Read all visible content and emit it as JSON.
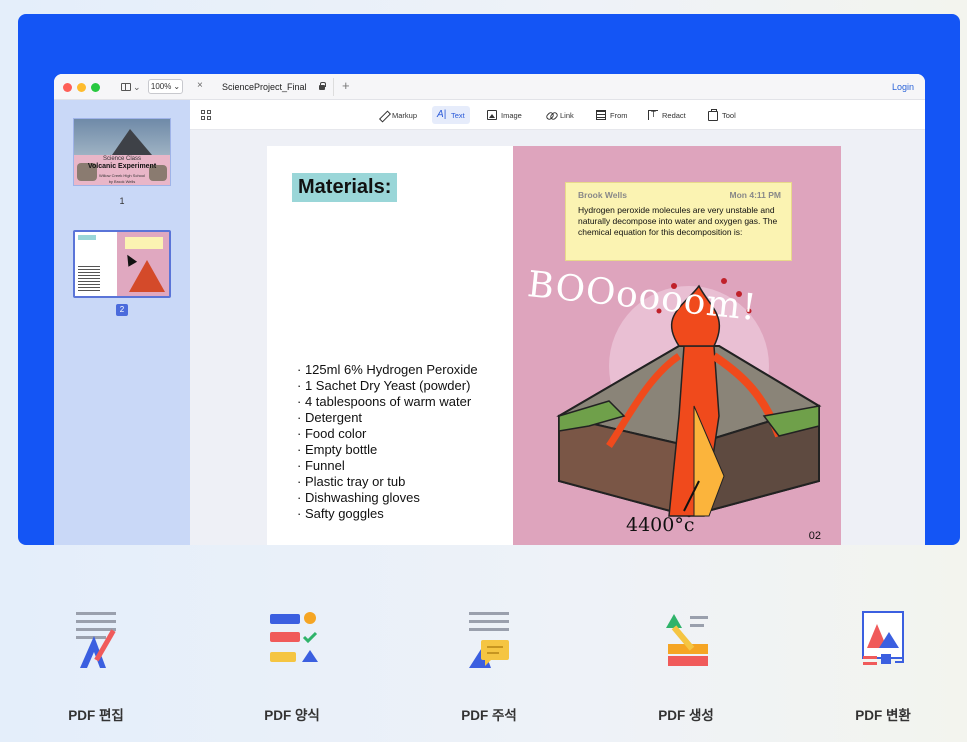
{
  "window": {
    "tab_title": "ScienceProject_Final",
    "zoom_level": "100%",
    "login_label": "Login",
    "close_glyph": "×",
    "add_glyph": "+"
  },
  "toolbar": {
    "tools": [
      {
        "label": "Markup",
        "icon": "pen-icon"
      },
      {
        "label": "Text",
        "icon": "text-icon",
        "active": true
      },
      {
        "label": "Image",
        "icon": "image-icon"
      },
      {
        "label": "Link",
        "icon": "link-icon"
      },
      {
        "label": "From",
        "icon": "form-icon"
      },
      {
        "label": "Redact",
        "icon": "redact-icon"
      },
      {
        "label": "Tool",
        "icon": "toolbox-icon"
      }
    ]
  },
  "sidebar": {
    "thumbnails": [
      {
        "page": "1",
        "line1": "Science Class",
        "line2": "Volcanic Experiment",
        "line3": "Willow Creek High School",
        "line4": "by Brook Wells"
      },
      {
        "page": "2",
        "selected": true
      }
    ]
  },
  "document": {
    "heading": "Materials:",
    "items": [
      "125ml 6% Hydrogen Peroxide",
      "1 Sachet Dry Yeast (powder)",
      "4 tablespoons of warm water",
      "Detergent",
      "Food color",
      "Empty bottle",
      "Funnel",
      "Plastic tray or tub",
      "Dishwashing gloves",
      "Safty goggles"
    ],
    "note": {
      "author": "Brook Wells",
      "time": "Mon 4:11 PM",
      "body": "Hydrogen peroxide molecules are very unstable and naturally decompose into water and oxygen gas. The chemical equation for this decomposition is:"
    },
    "boom_text": "BOOoooom!",
    "temperature": "4400°c",
    "page_number": "02"
  },
  "features": [
    {
      "label": "PDF 편집",
      "icon": "pdf-edit-icon"
    },
    {
      "label": "PDF 양식",
      "icon": "pdf-form-icon"
    },
    {
      "label": "PDF 주석",
      "icon": "pdf-annotate-icon"
    },
    {
      "label": "PDF 생성",
      "icon": "pdf-create-icon"
    },
    {
      "label": "PDF 변환",
      "icon": "pdf-convert-icon"
    }
  ],
  "colors": {
    "hero_blue": "#1455f5",
    "accent_blue": "#2a5ad8",
    "sidebar_bg": "#c9d8f7",
    "note_yellow": "#fbf3b2",
    "page_pink": "#dea4bd",
    "heading_teal": "#9ad6d8"
  }
}
